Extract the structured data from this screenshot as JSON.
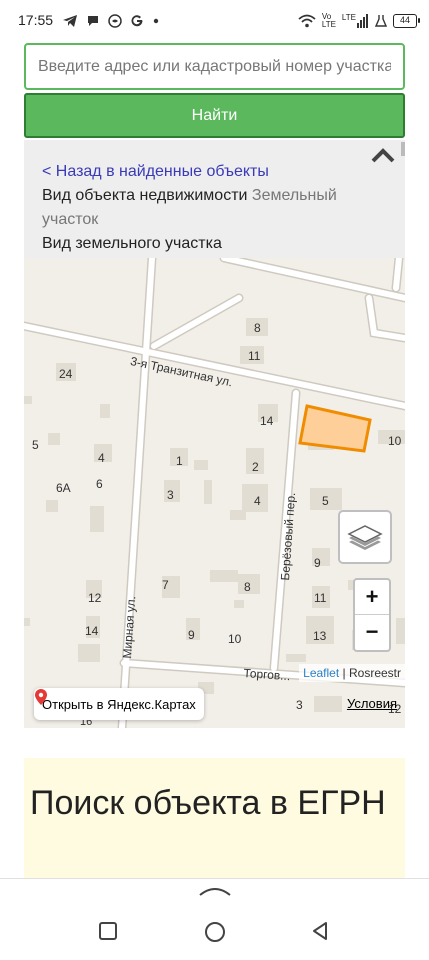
{
  "status_bar": {
    "time": "17:55",
    "volte": "Vo",
    "lte": "LTE",
    "lte2": "LTE",
    "battery": "44",
    "icons": [
      "telegram-icon",
      "message-icon",
      "vpn-icon",
      "google-icon",
      "dot-icon",
      "wifi-icon",
      "signal-icon",
      "flask-icon"
    ]
  },
  "search": {
    "placeholder": "Введите адрес или кадастровый номер участка",
    "button_label": "Найти"
  },
  "info": {
    "back_link": "< Назад в найденные объекты",
    "property_type_label": "Вид объекта недвижимости",
    "property_type_value": "Земельный участок",
    "land_type_label": "Вид земельного участка"
  },
  "map": {
    "streets": {
      "tranzitnaya": "3-я Транзитная ул.",
      "mirnaya": "Мирная ул.",
      "berezovy": "Берёзовый пер.",
      "torgovaya": "Торгов..."
    },
    "house_numbers": [
      "8",
      "11",
      "24",
      "14",
      "10",
      "5",
      "4",
      "1",
      "2",
      "6А",
      "6",
      "3",
      "4",
      "5",
      "9",
      "7",
      "8",
      "12",
      "11",
      "14",
      "9",
      "10",
      "13",
      "3",
      "12",
      "16"
    ],
    "attribution_leaflet": "Leaflet",
    "attribution_sep": "|",
    "attribution_source": "Rosreestr",
    "yandex_button": "Открыть в Яндекс.Картах",
    "terms_link": "Условия",
    "zoom_in": "+",
    "zoom_out": "−",
    "colors": {
      "highlight_fill": "#ffcf99",
      "highlight_stroke": "#f08c00",
      "background": "#f2efe9"
    }
  },
  "egrn": {
    "title": "Поиск объекта в ЕГРН"
  }
}
